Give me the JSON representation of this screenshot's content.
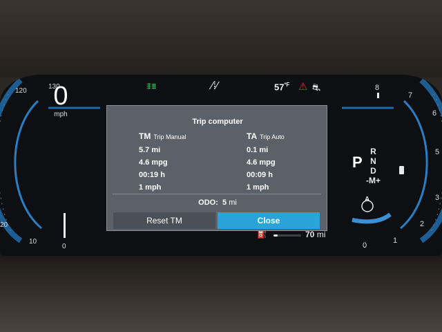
{
  "popup": {
    "title": "Trip computer",
    "trip_manual": {
      "abbr": "TM",
      "name": "Trip Manual",
      "distance": "5.7 mi",
      "consumption": "4.6 mpg",
      "time": "00:19 h",
      "avg_speed": "1 mph"
    },
    "trip_auto": {
      "abbr": "TA",
      "name": "Trip Auto",
      "distance": "0.1 mi",
      "consumption": "4.6 mpg",
      "time": "00:09 h",
      "avg_speed": "1 mph"
    },
    "odo_label": "ODO:",
    "odo_value": "5",
    "odo_unit": "mi",
    "reset_label": "Reset TM",
    "close_label": "Close"
  },
  "speedometer": {
    "speed": "0",
    "unit": "mph",
    "ticks": [
      "130",
      "120",
      "20",
      "10",
      "0"
    ]
  },
  "tachometer": {
    "ticks": [
      "8",
      "7",
      "6",
      "5",
      "3",
      "2",
      "1",
      "0"
    ],
    "auto_hold": "A"
  },
  "indicators": {
    "temperature": "57",
    "temperature_unit": "ºF"
  },
  "gear": {
    "current": "P",
    "options": [
      "R",
      "N",
      "D",
      "-M+"
    ]
  },
  "range": {
    "value": "70",
    "unit": "mi"
  },
  "colors": {
    "accent_blue": "#2aa4d8",
    "indicator_green": "#3fcf6b",
    "warning_red": "#e0322e"
  }
}
